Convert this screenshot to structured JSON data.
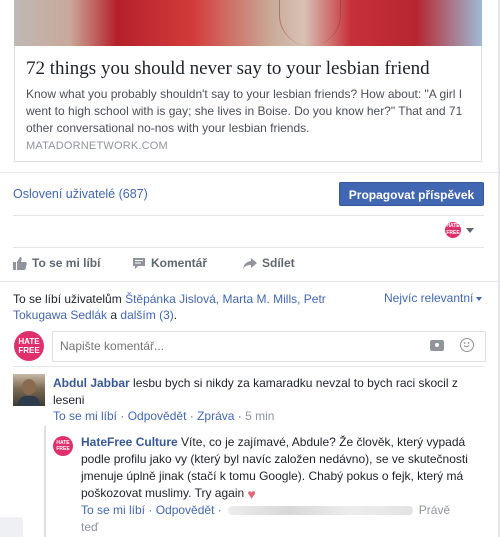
{
  "link": {
    "title": "72 things you should never say to your lesbian friend",
    "description": "Know what you probably shouldn't say to your lesbian friends? How about: \"A girl I went to high school with is gay; she lives in Boise. Do you know her?\" That and 71 other conversational no-nos with your lesbian friends.",
    "domain": "MATADORNETWORK.COM"
  },
  "reach": {
    "label": "Oslovení uživatelé (687)"
  },
  "promote": {
    "label": "Propagovat příspěvek"
  },
  "page_avatar": {
    "text": "HATE FREE"
  },
  "actions": {
    "like": "To se mi líbí",
    "comment": "Komentář",
    "share": "Sdílet"
  },
  "likes": {
    "prefix": "To se líbí uživatelům",
    "names": "Štěpánka Jislová, Marta M. Mills, Petr Tokugawa Sedlák",
    "conj": " a ",
    "others": "dalším (3)",
    "suffix": "."
  },
  "sort": {
    "label": "Nejvíc relevantní"
  },
  "comment_input": {
    "placeholder": "Napište komentář..."
  },
  "comments": [
    {
      "author": "Abdul Jabbar",
      "text": "lesbu bych si nikdy za kamaradku nevzal to bych raci skocil z leseni",
      "like": "To se mi líbí",
      "reply": "Odpovědět",
      "report": "Zpráva",
      "time": "5 min"
    }
  ],
  "reply": {
    "author": "HateFree Culture",
    "text": "Víte, co je zajímavé, Abdule? Že člověk, který vypadá podle profilu jako vy (který byl navíc založen nedávno), se ve skutečnosti jmenuje úplně jinak (stačí k tomu Google). Chabý pokus o fejk, který má poškozovat muslimy. Try again",
    "like": "To se mi líbí",
    "reply": "Odpovědět",
    "time": "Právě teď"
  },
  "colors": {
    "brand": "#4267b2",
    "hatefree": "#e0306b"
  }
}
